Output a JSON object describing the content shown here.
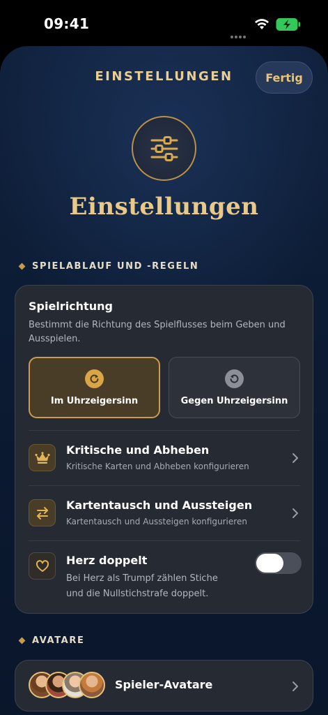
{
  "status_bar": {
    "time": "09:41"
  },
  "nav": {
    "title": "EINSTELLUNGEN",
    "done_label": "Fertig"
  },
  "hero": {
    "title": "Einstellungen",
    "icon": "sliders-icon"
  },
  "sections": {
    "rules": "SPIELABLAUF UND -REGELN",
    "avatars": "AVATARE"
  },
  "direction": {
    "title": "Spielrichtung",
    "description": "Bestimmt die Richtung des Spielflusses beim Geben und Ausspielen.",
    "options": [
      {
        "label": "Im Uhrzeigersinn",
        "selected": true,
        "icon": "clockwise-icon"
      },
      {
        "label": "Gegen Uhrzeigersinn",
        "selected": false,
        "icon": "counterclockwise-icon"
      }
    ]
  },
  "rows": [
    {
      "title": "Kritische und Abheben",
      "subtitle": "Kritische Karten und Abheben konfigurieren",
      "icon": "crown-icon"
    },
    {
      "title": "Kartentausch und Aussteigen",
      "subtitle": "Kartentausch und Aussteigen konfigurieren",
      "icon": "swap-arrows-icon"
    }
  ],
  "heart_double": {
    "title": "Herz doppelt",
    "subtitle_line1": "Bei Herz als Trumpf zählen Stiche",
    "subtitle_line2": "und die Nullstichstrafe doppelt.",
    "enabled": false,
    "icon": "heart-icon"
  },
  "avatars_row": {
    "title": "Spieler-Avatare"
  },
  "colors": {
    "accent_gold": "#e9c98a",
    "selected_fill": "#4a3d27",
    "card_bg": "#262a33"
  }
}
